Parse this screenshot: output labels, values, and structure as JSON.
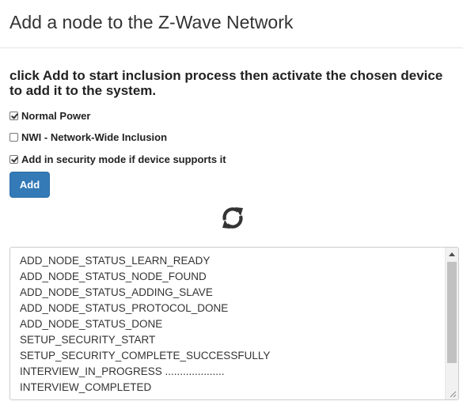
{
  "dialog": {
    "title": "Add a node to the Z-Wave Network",
    "instruction": "click Add to start inclusion process then activate the chosen device to add it to the system."
  },
  "options": [
    {
      "label": "Normal Power",
      "checked": true
    },
    {
      "label": "NWI - Network-Wide Inclusion",
      "checked": false
    },
    {
      "label": "Add in security mode if device supports it",
      "checked": true
    }
  ],
  "add_button": {
    "label": "Add",
    "color": "#337ab7"
  },
  "status_icon": "refresh-icon",
  "log": {
    "lines": [
      "ADD_NODE_STATUS_LEARN_READY",
      "ADD_NODE_STATUS_NODE_FOUND",
      "ADD_NODE_STATUS_ADDING_SLAVE",
      "ADD_NODE_STATUS_PROTOCOL_DONE",
      "ADD_NODE_STATUS_DONE",
      "SETUP_SECURITY_START",
      "SETUP_SECURITY_COMPLETE_SUCCESSFULLY",
      "INTERVIEW_IN_PROGRESS ....................",
      "INTERVIEW_COMPLETED"
    ]
  }
}
